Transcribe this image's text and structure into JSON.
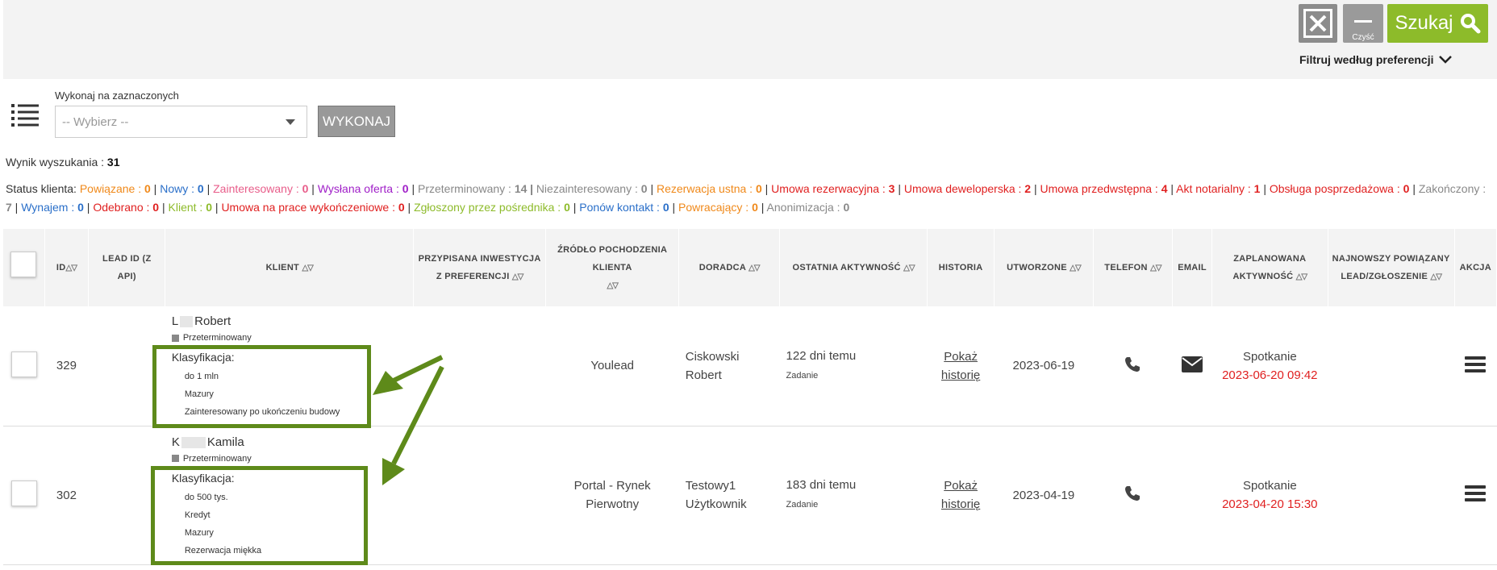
{
  "toolbar": {
    "clear_label": "Czyść",
    "search_label": "Szukaj",
    "filter_pref_label": "Filtruj według preferencji"
  },
  "bulk": {
    "label": "Wykonaj na zaznaczonych",
    "placeholder": "-- Wybierz --",
    "execute_label": "WYKONAJ"
  },
  "results": {
    "label": "Wynik wyszukania :",
    "count": "31"
  },
  "status_label": "Status klienta:",
  "statuses": [
    {
      "name": "Powiązane",
      "count": "0",
      "color": "#f0891a"
    },
    {
      "name": "Nowy",
      "count": "0",
      "color": "#2a6fc9"
    },
    {
      "name": "Zainteresowany",
      "count": "0",
      "color": "#e85d8a"
    },
    {
      "name": "Wysłana oferta",
      "count": "0",
      "color": "#a020c8"
    },
    {
      "name": "Przeterminowany",
      "count": "14",
      "color": "#888888"
    },
    {
      "name": "Niezainteresowany",
      "count": "0",
      "color": "#888888"
    },
    {
      "name": "Rezerwacja ustna",
      "count": "0",
      "color": "#f0891a"
    },
    {
      "name": "Umowa rezerwacyjna",
      "count": "3",
      "color": "#e02020"
    },
    {
      "name": "Umowa deweloperska",
      "count": "2",
      "color": "#e02020"
    },
    {
      "name": "Umowa przedwstępna",
      "count": "4",
      "color": "#e02020"
    },
    {
      "name": "Akt notarialny",
      "count": "1",
      "color": "#e02020"
    },
    {
      "name": "Obsługa posprzedażowa",
      "count": "0",
      "color": "#e02020"
    },
    {
      "name": "Zakończony",
      "count": "7",
      "color": "#888888"
    },
    {
      "name": "Wynajem",
      "count": "0",
      "color": "#2a6fc9"
    },
    {
      "name": "Odebrano",
      "count": "0",
      "color": "#e02020"
    },
    {
      "name": "Klient",
      "count": "0",
      "color": "#8dbb2a"
    },
    {
      "name": "Umowa na prace wykończeniowe",
      "count": "0",
      "color": "#e02020"
    },
    {
      "name": "Zgłoszony przez pośrednika",
      "count": "0",
      "color": "#8dbb2a"
    },
    {
      "name": "Ponów kontakt",
      "count": "0",
      "color": "#2a6fc9"
    },
    {
      "name": "Powracający",
      "count": "0",
      "color": "#f0891a"
    },
    {
      "name": "Anonimizacja",
      "count": "0",
      "color": "#888888"
    }
  ],
  "table": {
    "headers": {
      "id": "ID",
      "lead_id": "LEAD ID (Z API)",
      "klient": "KLIENT",
      "inwestycja": "PRZYPISANA INWESTYCJA Z PREFERENCJI",
      "zrodlo": "ŹRÓDŁO POCHODZENIA KLIENTA",
      "doradca": "DORADCA",
      "aktywnosc": "OSTATNIA AKTYWNOŚĆ",
      "historia": "HISTORIA",
      "utworzone": "UTWORZONE",
      "telefon": "TELEFON",
      "email": "EMAIL",
      "zaplanowana": "ZAPLANOWANA AKTYWNOŚĆ",
      "najnowszy": "NAJNOWSZY POWIĄZANY LEAD/ZGŁOSZENIE",
      "akcja": "AKCJA"
    },
    "rows": [
      {
        "id": "329",
        "name_initial": "L",
        "name_rest": "Robert",
        "status": "Przeterminowany",
        "klas_label": "Klasyfikacja:",
        "klas": [
          "do 1 mln",
          "Mazury",
          "Zainteresowany po ukończeniu budowy"
        ],
        "zrodlo": "Youlead",
        "doradca1": "Ciskowski",
        "doradca2": "Robert",
        "aktywnosc": "122 dni temu",
        "aktywnosc_typ": "Zadanie",
        "historia1": "Pokaż",
        "historia2": "historię",
        "utworzone": "2023-06-19",
        "zapl_typ": "Spotkanie",
        "zapl_data": "2023-06-20 09:42"
      },
      {
        "id": "302",
        "name_initial": "K",
        "name_rest": "Kamila",
        "status": "Przeterminowany",
        "klas_label": "Klasyfikacja:",
        "klas": [
          "do 500 tys.",
          "Kredyt",
          "Mazury",
          "Rezerwacja miękka"
        ],
        "zrodlo1": "Portal - Rynek",
        "zrodlo2": "Pierwotny",
        "doradca1": "Testowy1",
        "doradca2": "Użytkownik",
        "aktywnosc": "183 dni temu",
        "aktywnosc_typ": "Zadanie",
        "historia1": "Pokaż",
        "historia2": "historię",
        "utworzone": "2023-04-19",
        "zapl_typ": "Spotkanie",
        "zapl_data": "2023-04-20 15:30"
      }
    ]
  },
  "colors": {
    "accent_green": "#8dbb2a",
    "annotation_green": "#5e8a1a",
    "date_red": "#e02020"
  },
  "icons": [
    "close-x-icon",
    "search-icon",
    "chevron-down-icon",
    "list-icon",
    "phone-icon",
    "envelope-icon",
    "hamburger-icon",
    "sort-icon"
  ]
}
